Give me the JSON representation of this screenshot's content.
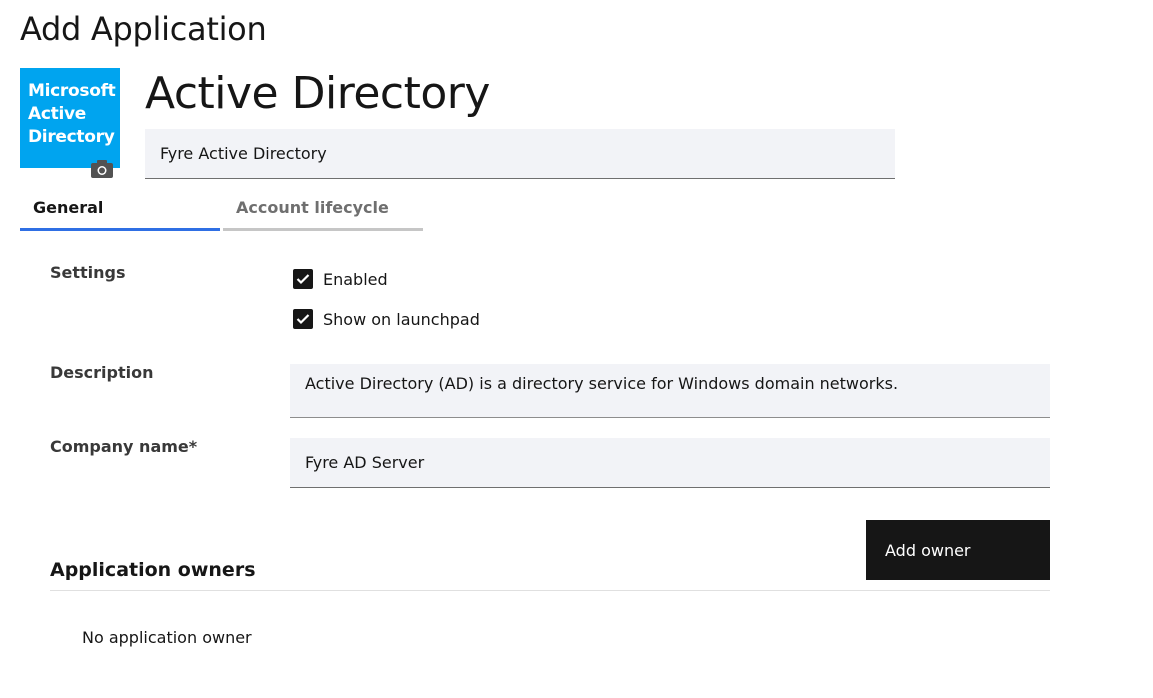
{
  "page": {
    "title": "Add Application"
  },
  "app": {
    "logo_lines": [
      "Microsoft",
      "Active",
      "Directory"
    ],
    "logo_color": "#00a4ef",
    "camera_icon": "camera-icon",
    "name": "Active Directory",
    "display_name_value": "Fyre Active Directory"
  },
  "tabs": [
    {
      "label": "General",
      "selected": true
    },
    {
      "label": "Account lifecycle",
      "selected": false
    }
  ],
  "settings": {
    "label": "Settings",
    "options": [
      {
        "label": "Enabled",
        "checked": true
      },
      {
        "label": "Show on launchpad",
        "checked": true
      }
    ]
  },
  "description": {
    "label": "Description",
    "value": "Active Directory (AD) is a directory service for Windows domain networks."
  },
  "company": {
    "label": "Company name*",
    "value": "Fyre AD Server"
  },
  "owners": {
    "heading": "Application owners",
    "add_button": "Add owner",
    "empty_text": "No application owner"
  },
  "colors": {
    "accent": "#2f6fe4",
    "field_bg": "#f2f3f7",
    "primary_button": "#161616"
  }
}
